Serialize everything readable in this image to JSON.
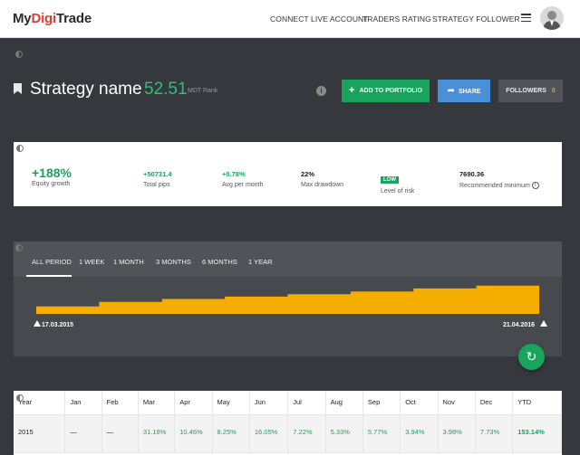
{
  "brand": {
    "prefix": "My",
    "highlight": "Digi",
    "suffix": "Trade"
  },
  "nav": {
    "connect": "CONNECT LIVE ACCOUNT",
    "rating": "TRADERS RATING",
    "follower": "STRATEGY FOLLOWER"
  },
  "strategy": {
    "name": "Strategy name",
    "score": "52.51",
    "rank_label": "MDT Rank",
    "info": "i"
  },
  "actions": {
    "add": "ADD TO PORTFOLIO",
    "share": "SHARE",
    "followers": "FOLLOWERS",
    "followers_count": "0"
  },
  "stats": {
    "equity_value": "+188%",
    "equity_label": "Equity growth",
    "pips_value": "+50731.4",
    "pips_label": "Total pips",
    "avg_value": "+0.78%",
    "avg_label": "Avg per month",
    "drawdown_value": "22%",
    "drawdown_label": "Max drawdown",
    "risk_value": "LOW",
    "risk_label": "Level of risk",
    "min_value": "7690.36",
    "min_label": "Recommended minimum",
    "info": "i"
  },
  "chart": {
    "periods": [
      "ALL PERIOD",
      "1 WEEK",
      "1 MONTH",
      "3 MONTHS",
      "6 MONTHS",
      "1 YEAR"
    ],
    "active_period": "ALL PERIOD",
    "start_date": "17.03.2015",
    "end_date": "21.04.2016",
    "fill_color": "#f5ad00"
  },
  "chart_data": {
    "type": "area",
    "x": [
      "17.03.2015",
      "21.04.2016"
    ],
    "series": [
      {
        "values": [
          0.25,
          0.4,
          0.5,
          0.58,
          0.66,
          0.75,
          0.85,
          0.95
        ]
      }
    ],
    "grid": false
  },
  "table": {
    "headers": [
      "Year",
      "Jan",
      "Feb",
      "Mar",
      "Apr",
      "May",
      "Jun",
      "Jul",
      "Aug",
      "Sep",
      "Oct",
      "Nov",
      "Dec",
      "YTD"
    ],
    "rows": [
      [
        "2015",
        "—",
        "—",
        "31.18%",
        "10.46%",
        "8.25%",
        "16.05%",
        "7.22%",
        "5.33%",
        "5.77%",
        "3.94%",
        "3.98%",
        "7.73%",
        "153.14%"
      ]
    ]
  },
  "colors": {
    "accent_green": "#1aa35d",
    "share_blue": "#4a90d9",
    "brand_red": "#e03b2e"
  }
}
